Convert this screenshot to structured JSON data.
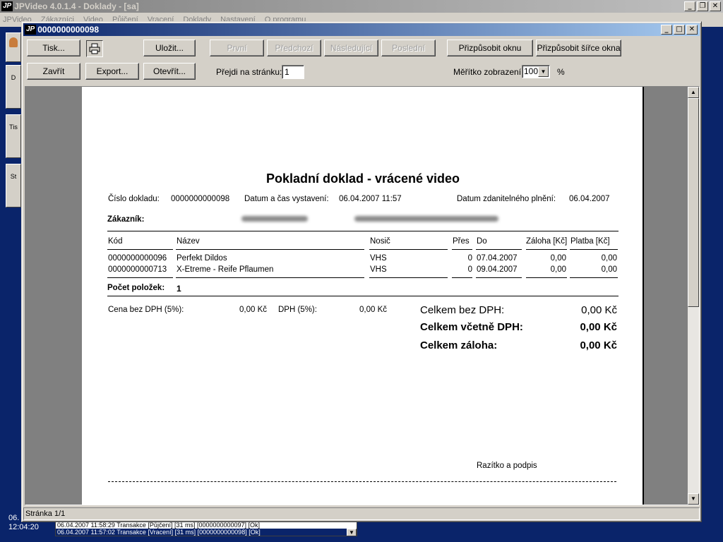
{
  "main_window": {
    "logo": "JP",
    "title": "JPVideo 4.0.1.4 - Doklady - [sa]",
    "menu": [
      "JPVideo",
      "Zákazníci",
      "Video",
      "Půjčení",
      "Vracení",
      "Doklady",
      "Nastavení",
      "O programu"
    ],
    "controls": {
      "minimize": "_",
      "restore": "❐",
      "close": "✕"
    }
  },
  "side_panel": {
    "buttons": [
      "",
      "D",
      "Tis",
      "St"
    ],
    "date_partial": "06.",
    "time": "12:04:20"
  },
  "log": {
    "lines": [
      "06.04.2007 11:58:29 Transakce [Půjčení] [31 ms] [0000000000097] [Ok]",
      "06.04.2007 11:57:02 Transakce [Vracení] [31 ms] [0000000000098] [Ok]"
    ]
  },
  "preview_window": {
    "logo": "JP",
    "title": "0000000000098",
    "controls": {
      "minimize": "_",
      "maximize": "□",
      "close": "✕"
    }
  },
  "toolbar": {
    "print": "Tisk...",
    "save": "Uložit...",
    "first": "První",
    "previous": "Předchozí",
    "next": "Následující",
    "last": "Poslední",
    "fit_window": "Přizpůsobit oknu",
    "fit_width": "Přizpůsobit šířce okna",
    "close": "Zavřít",
    "export": "Export...",
    "open": "Otevřít...",
    "goto_label": "Přejdi na stránku:",
    "goto_value": "1",
    "zoom_label": "Měřítko zobrazení:",
    "zoom_value": "100",
    "zoom_unit": "%"
  },
  "document": {
    "title": "Pokladní doklad - vrácené video",
    "number_label": "Číslo dokladu:",
    "number": "0000000000098",
    "issued_label": "Datum a čas vystavení:",
    "issued": "06.04.2007 11:57",
    "taxdate_label": "Datum zdanitelného plnění:",
    "taxdate": "06.04.2007",
    "customer_label": "Zákazník:",
    "columns": {
      "code": "Kód",
      "name": "Název",
      "medium": "Nosič",
      "over": "Přes",
      "to": "Do",
      "deposit": "Záloha [Kč]",
      "payment": "Platba [Kč]"
    },
    "rows": [
      {
        "code": "0000000000096",
        "name": "Perfekt Dildos",
        "medium": "VHS",
        "over": "0",
        "to": "07.04.2007",
        "deposit": "0,00",
        "payment": "0,00"
      },
      {
        "code": "0000000000713",
        "name": "X-Etreme - Reife Pflaumen",
        "medium": "VHS",
        "over": "0",
        "to": "09.04.2007",
        "deposit": "0,00",
        "payment": "0,00"
      }
    ],
    "count_label": "Počet položek:",
    "count": "1",
    "price_novat_label": "Cena bez DPH (5%):",
    "price_novat": "0,00 Kč",
    "vat_label": "DPH (5%):",
    "vat": "0,00 Kč",
    "total_novat_label": "Celkem bez DPH:",
    "total_novat": "0,00 Kč",
    "total_vat_label": "Celkem včetně DPH:",
    "total_vat": "0,00 Kč",
    "total_deposit_label": "Celkem záloha:",
    "total_deposit": "0,00 Kč",
    "stamp_label": "Razítko a podpis"
  },
  "status": {
    "page": "Stránka 1/1"
  }
}
